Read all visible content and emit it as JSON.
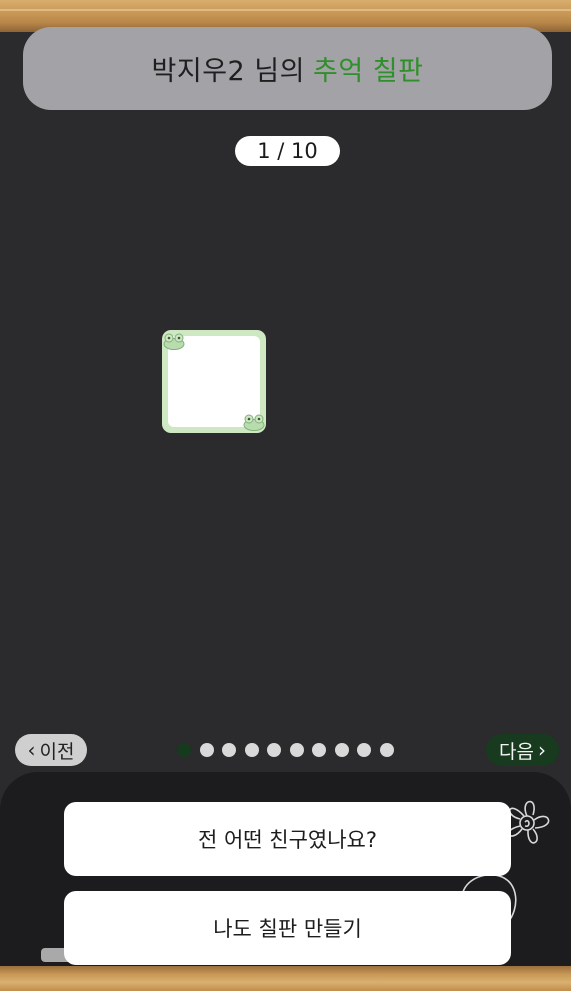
{
  "header": {
    "title_prefix": "박지우2 님의",
    "title_accent": "추억 칠판",
    "accent_color": "#2e8f2b"
  },
  "pager": {
    "counter": "1 / 10",
    "current": 1,
    "total": 10
  },
  "note": {
    "decoration": "frog-icon"
  },
  "navigation": {
    "prev_label": "이전",
    "next_label": "다음",
    "prev_icon": "chevron-left-icon",
    "next_icon": "chevron-right-icon"
  },
  "actions": {
    "who_label": "전 어떤 친구였나요?",
    "create_label": "나도 칠판 만들기"
  },
  "colors": {
    "board": "#2b2a2d",
    "active_dot": "#163a1e",
    "next_button": "#183a1f"
  }
}
